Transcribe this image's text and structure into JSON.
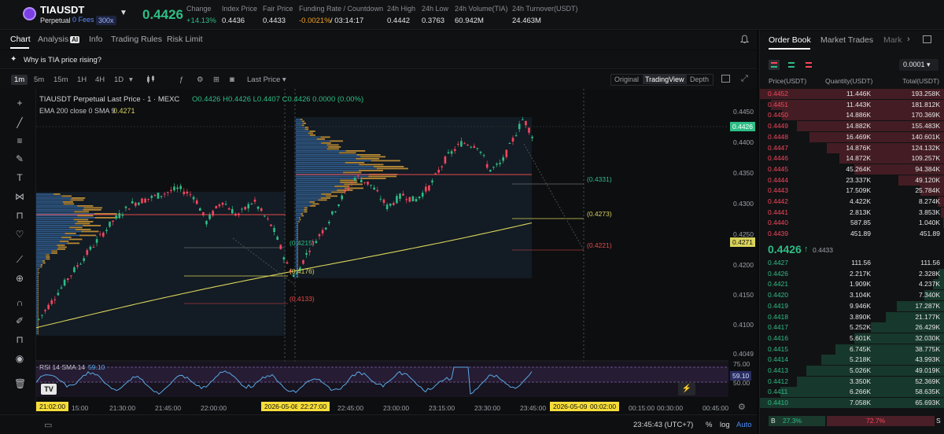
{
  "header": {
    "symbol": "TIAUSDT",
    "type": "Perpetual",
    "fees": "0 Fees",
    "leverage": "300x",
    "last_price": "0.4426",
    "stats": [
      {
        "label": "Change",
        "value": "+14.13%",
        "tone": "green"
      },
      {
        "label": "Index Price",
        "value": "0.4436",
        "tone": ""
      },
      {
        "label": "Fair Price",
        "value": "0.4433",
        "tone": ""
      },
      {
        "label": "Funding Rate / Countdown",
        "value": "-0.0021%",
        "value2": "/ 03:14:17",
        "tone": "orange"
      },
      {
        "label": "24h High",
        "value": "0.4442",
        "tone": ""
      },
      {
        "label": "24h Low",
        "value": "0.3763",
        "tone": ""
      },
      {
        "label": "24h Volume(TIA)",
        "value": "60.942M",
        "tone": ""
      },
      {
        "label": "24h Turnover(USDT)",
        "value": "24.463M",
        "tone": ""
      }
    ]
  },
  "tabs": {
    "chart": "Chart",
    "analysis": "Analysis",
    "analysis_badge": "AI",
    "info": "Info",
    "trading_rules": "Trading Rules",
    "risk_limit": "Risk Limit"
  },
  "prompt": "Why is TIA price rising?",
  "toolbar": {
    "timeframes": [
      "1m",
      "5m",
      "15m",
      "1H",
      "4H",
      "1D"
    ],
    "active_timeframe": "1m",
    "price_type": "Last Price",
    "views": [
      "Original",
      "TradingView",
      "Depth"
    ],
    "active_view": "TradingView"
  },
  "chart": {
    "legend_title": "TIAUSDT Perpetual Last Price · 1 · MEXC",
    "ohlc": "O0.4426 H0.4426 L0.4407 C0.4426 0.0000 (0.00%)",
    "ema_label": "EMA 200 close 0 SMA 9",
    "ema_value": "0.4271",
    "rsi_label": "RSI 14 SMA 14",
    "rsi_value": "59.10",
    "price_axis": [
      "0.4450",
      "0.4400",
      "0.4350",
      "0.4300",
      "0.4250",
      "0.4200",
      "0.4150",
      "0.4100",
      "0.4049"
    ],
    "price_tag": "0.4426",
    "ema_tag": "0.4271",
    "rsi_axis": [
      "75.00",
      "50.00"
    ],
    "rsi_tag": "59.10",
    "annotations": [
      {
        "text": "(0.4331)",
        "tone": "green"
      },
      {
        "text": "(0.4273)",
        "tone": "yellow"
      },
      {
        "text": "(0.4221)",
        "tone": "red"
      },
      {
        "text": "(0.4215)",
        "tone": "green"
      },
      {
        "text": "(0.4176)",
        "tone": "yellow"
      },
      {
        "text": "(0.4133)",
        "tone": "red"
      }
    ],
    "time_axis": [
      "21:02:00",
      "15:00",
      "21:30:00",
      "21:45:00",
      "22:00:00",
      "2026-05-08",
      "22:27:00",
      "22:45:00",
      "23:00:00",
      "23:15:00",
      "23:30:00",
      "23:45:00",
      "2026-05-09",
      "00:02:00",
      "00:15:00",
      "00:30:00",
      "00:45:00"
    ]
  },
  "bottom": {
    "clock": "23:45:43 (UTC+7)",
    "percent": "%",
    "log": "log",
    "auto": "Auto"
  },
  "orderbook": {
    "tabs": [
      "Order Book",
      "Market Trades",
      "Mark"
    ],
    "precision": "0.0001",
    "headers": [
      "Price(USDT)",
      "Quantity(USDT)",
      "Total(USDT)"
    ],
    "asks": [
      {
        "price": "0.4452",
        "qty": "11.446K",
        "total": "193.258K",
        "depth": 1.0
      },
      {
        "price": "0.4451",
        "qty": "11.443K",
        "total": "181.812K",
        "depth": 0.94
      },
      {
        "price": "0.4450",
        "qty": "14.886K",
        "total": "170.369K",
        "depth": 0.88
      },
      {
        "price": "0.4449",
        "qty": "14.882K",
        "total": "155.483K",
        "depth": 0.8
      },
      {
        "price": "0.4448",
        "qty": "16.469K",
        "total": "140.601K",
        "depth": 0.73
      },
      {
        "price": "0.4447",
        "qty": "14.876K",
        "total": "124.132K",
        "depth": 0.64
      },
      {
        "price": "0.4446",
        "qty": "14.872K",
        "total": "109.257K",
        "depth": 0.57
      },
      {
        "price": "0.4445",
        "qty": "45.264K",
        "total": "94.384K",
        "depth": 0.49
      },
      {
        "price": "0.4444",
        "qty": "23.337K",
        "total": "49.120K",
        "depth": 0.25
      },
      {
        "price": "0.4443",
        "qty": "17.509K",
        "total": "25.784K",
        "depth": 0.13
      },
      {
        "price": "0.4442",
        "qty": "4.422K",
        "total": "8.274K",
        "depth": 0.04
      },
      {
        "price": "0.4441",
        "qty": "2.813K",
        "total": "3.853K",
        "depth": 0.02
      },
      {
        "price": "0.4440",
        "qty": "587.85",
        "total": "1.040K",
        "depth": 0.01
      },
      {
        "price": "0.4439",
        "qty": "451.89",
        "total": "451.89",
        "depth": 0.005
      }
    ],
    "mid_price": "0.4426",
    "mid_arrow": "↑",
    "mid_ref": "0.4433",
    "bids": [
      {
        "price": "0.4427",
        "qty": "111.56",
        "total": "111.56",
        "depth": 0.002
      },
      {
        "price": "0.4426",
        "qty": "2.217K",
        "total": "2.328K",
        "depth": 0.035
      },
      {
        "price": "0.4421",
        "qty": "1.909K",
        "total": "4.237K",
        "depth": 0.065
      },
      {
        "price": "0.4420",
        "qty": "3.104K",
        "total": "7.340K",
        "depth": 0.11
      },
      {
        "price": "0.4419",
        "qty": "9.946K",
        "total": "17.287K",
        "depth": 0.26
      },
      {
        "price": "0.4418",
        "qty": "3.890K",
        "total": "21.177K",
        "depth": 0.32
      },
      {
        "price": "0.4417",
        "qty": "5.252K",
        "total": "26.429K",
        "depth": 0.4
      },
      {
        "price": "0.4416",
        "qty": "5.601K",
        "total": "32.030K",
        "depth": 0.49
      },
      {
        "price": "0.4415",
        "qty": "6.745K",
        "total": "38.775K",
        "depth": 0.59
      },
      {
        "price": "0.4414",
        "qty": "5.218K",
        "total": "43.993K",
        "depth": 0.67
      },
      {
        "price": "0.4413",
        "qty": "5.026K",
        "total": "49.019K",
        "depth": 0.75
      },
      {
        "price": "0.4412",
        "qty": "3.350K",
        "total": "52.369K",
        "depth": 0.8
      },
      {
        "price": "0.4411",
        "qty": "6.266K",
        "total": "58.635K",
        "depth": 0.89
      },
      {
        "price": "0.4410",
        "qty": "7.058K",
        "total": "65.693K",
        "depth": 1.0
      }
    ],
    "buy_label": "B",
    "buy_ratio": "27.3%",
    "sell_ratio": "72.7%",
    "sell_label": "S"
  },
  "colors": {
    "up": "#2ebd85",
    "down": "#f6465d",
    "ema": "#d9d35a",
    "rsi": "#5aa9e6",
    "accent": "#f6dd3a"
  }
}
